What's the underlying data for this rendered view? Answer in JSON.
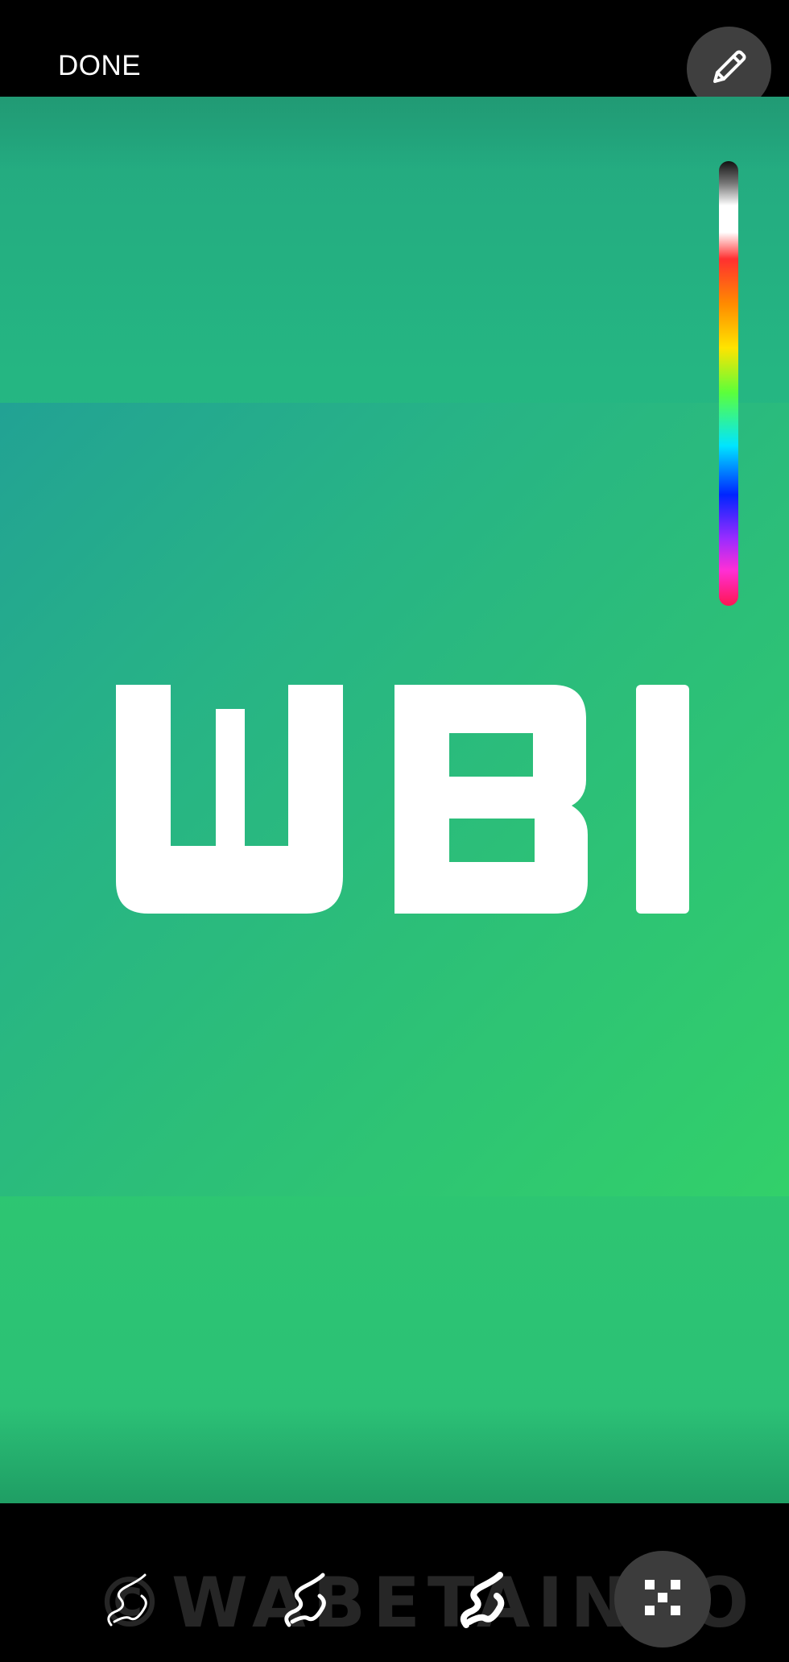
{
  "toolbar": {
    "done_label": "DONE"
  },
  "logo": {
    "text": "WBI"
  },
  "watermark": {
    "text": "©WABETAINFO"
  },
  "brushes": [
    {
      "icon": "brush-thin-icon"
    },
    {
      "icon": "brush-medium-icon"
    },
    {
      "icon": "brush-thick-icon"
    }
  ],
  "tools": {
    "pencil_icon": "pencil-icon",
    "mosaic_icon": "mosaic-icon"
  },
  "colors": {
    "background": "#2ab87c",
    "accent": "#ffffff",
    "button": "#3f3f3f"
  }
}
